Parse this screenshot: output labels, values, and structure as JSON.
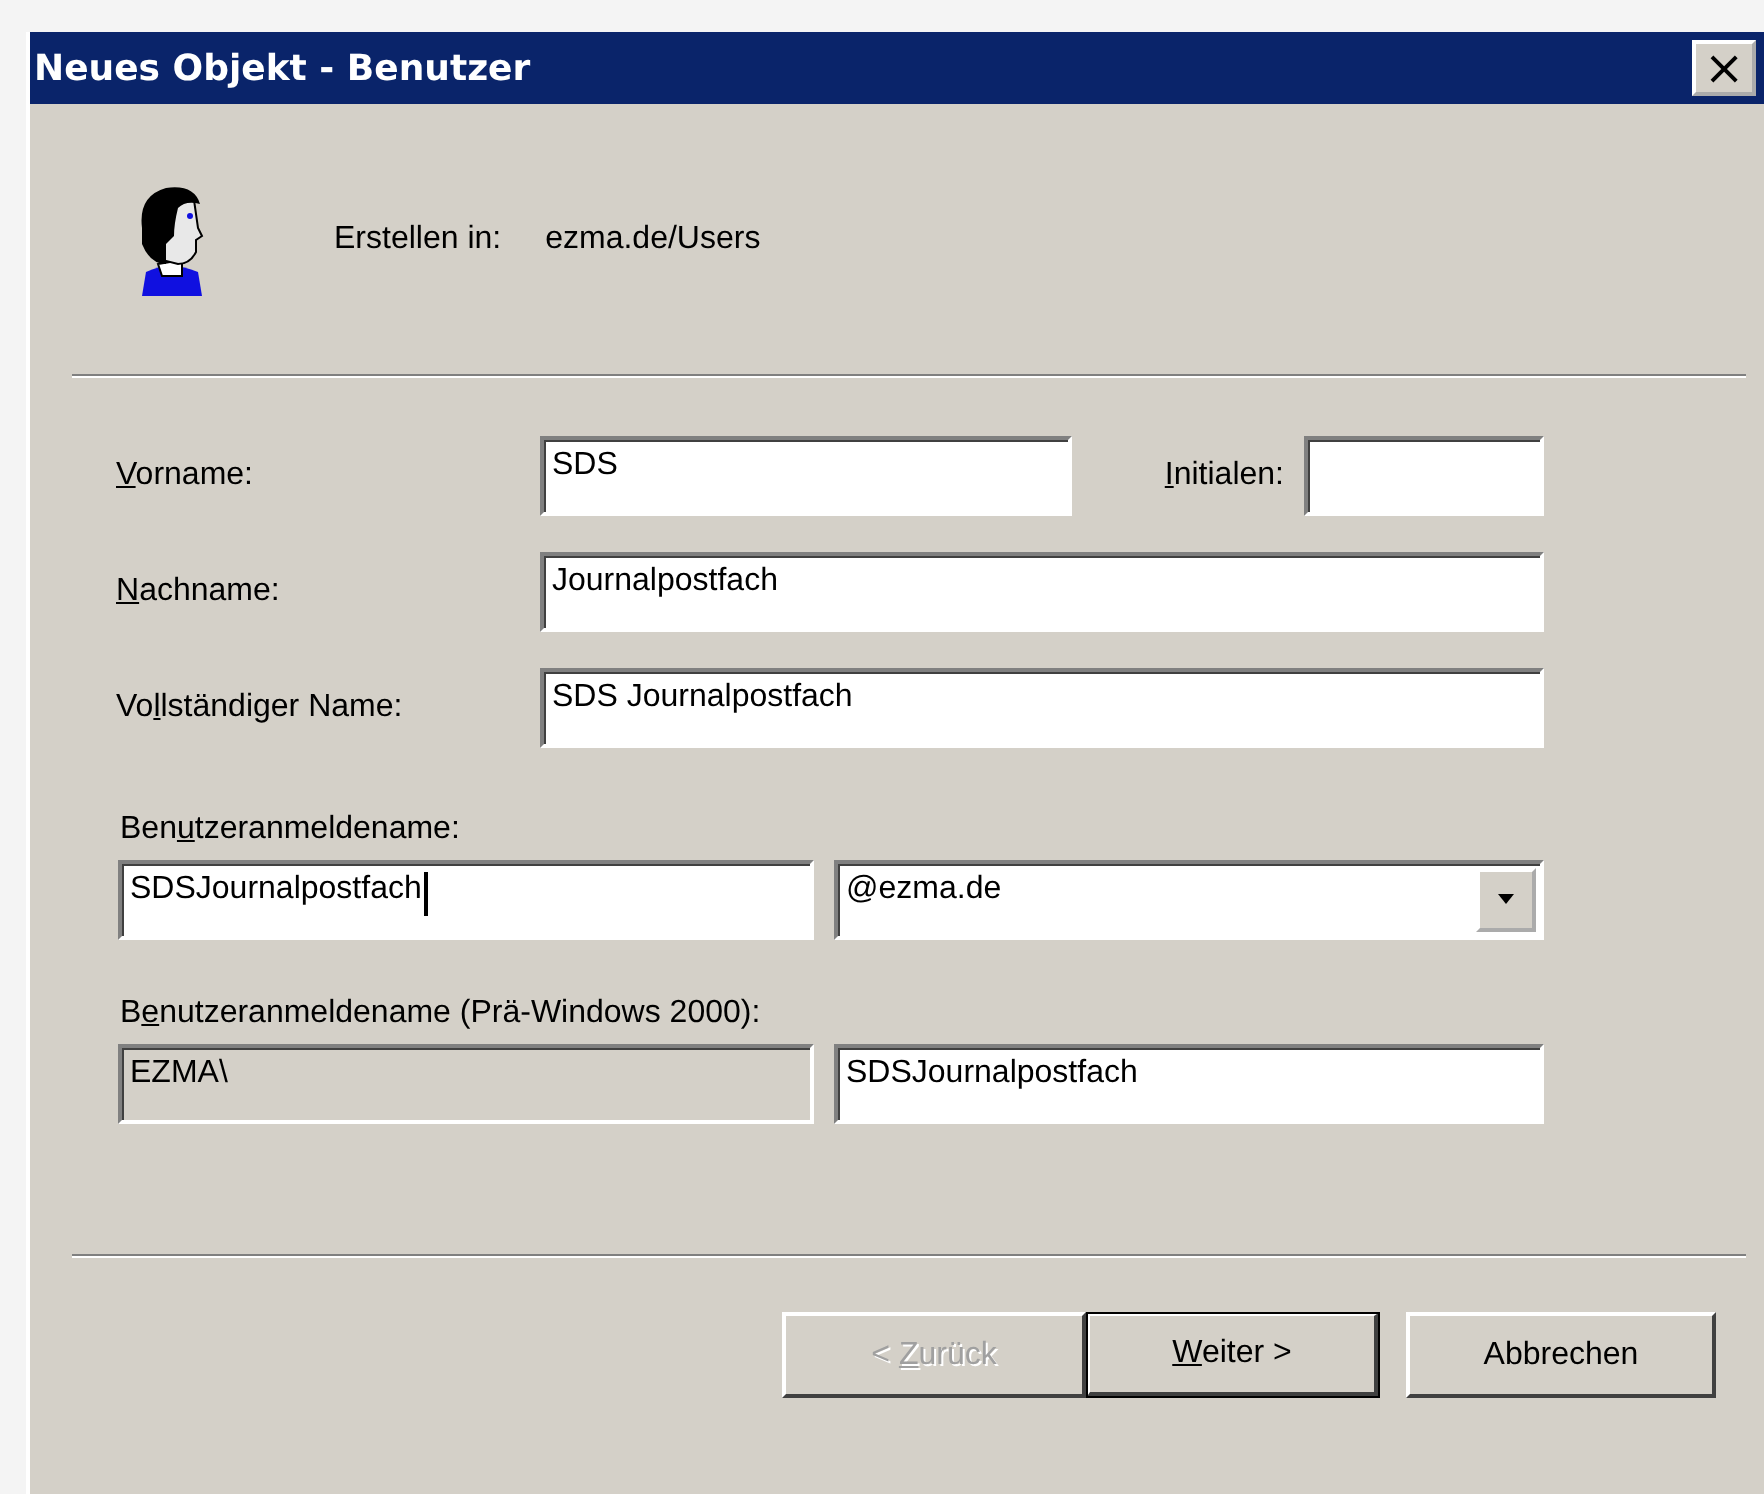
{
  "window": {
    "title": "Neues Objekt - Benutzer",
    "close": "×"
  },
  "create_in": {
    "label": "Erstellen in:",
    "value": "ezma.de/Users"
  },
  "first_name": {
    "label": {
      "key": "V",
      "post": "orname:"
    },
    "value": "SDS"
  },
  "initials": {
    "label": {
      "key": "I",
      "post": "nitialen:"
    }
  },
  "last_name": {
    "label": {
      "key": "N",
      "post": "achname:"
    },
    "value": "Journalpostfach"
  },
  "full_name": {
    "label": {
      "pre": "Vo",
      "key": "l",
      "post": "lständiger Name:"
    },
    "value": "SDS Journalpostfach"
  },
  "logon_name": {
    "label": {
      "pre": "Ben",
      "key": "u",
      "post": "tzeranmeldename:"
    },
    "value": "SDSJournalpostfach",
    "focused": true,
    "domain": "@ezma.de"
  },
  "pre2000": {
    "label": {
      "pre": "B",
      "key": "e",
      "post": "nutzeranmeldename (Prä-Windows 2000):"
    },
    "fields": [
      {
        "value": "EZMA\\",
        "disabled": true
      },
      {
        "value": "SDSJournalpostfach",
        "disabled": false
      }
    ]
  },
  "buttons": [
    {
      "label": {
        "pre": "< ",
        "key": "Z",
        "post": "urück"
      },
      "disabled": true,
      "default": false
    },
    {
      "label": {
        "key": "W",
        "post": "eiter >"
      },
      "disabled": false,
      "default": true
    },
    {
      "label": {
        "pre": "Abbrechen"
      },
      "disabled": false,
      "default": false
    }
  ]
}
